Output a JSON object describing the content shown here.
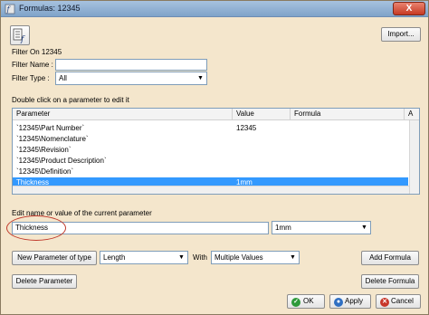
{
  "window": {
    "title": "Formulas: 12345",
    "close_label": "X"
  },
  "toolbar": {
    "import_label": "Import..."
  },
  "filter": {
    "heading": "Filter On 12345",
    "name_label": "Filter Name :",
    "name_value": "",
    "type_label": "Filter Type :",
    "type_value": "All"
  },
  "table": {
    "caption": "Double click on a parameter to edit it",
    "columns": [
      "Parameter",
      "Value",
      "Formula",
      "A"
    ],
    "rows": [
      {
        "parameter": "`12345\\Part Number`",
        "value": "12345",
        "formula": ""
      },
      {
        "parameter": "`12345\\Nomenclature`",
        "value": "",
        "formula": ""
      },
      {
        "parameter": "`12345\\Revision`",
        "value": "",
        "formula": ""
      },
      {
        "parameter": "`12345\\Product Description`",
        "value": "",
        "formula": ""
      },
      {
        "parameter": "`12345\\Definition`",
        "value": "",
        "formula": ""
      },
      {
        "parameter": "Thickness",
        "value": "1mm",
        "formula": "",
        "selected": true
      }
    ]
  },
  "edit": {
    "caption": "Edit name or value of the current parameter",
    "name_value": "Thickness",
    "value_value": "1mm"
  },
  "new_param": {
    "button_label": "New Parameter of type",
    "type_value": "Length",
    "with_label": "With",
    "with_value": "Multiple Values",
    "add_formula_label": "Add Formula"
  },
  "actions": {
    "delete_parameter_label": "Delete Parameter",
    "delete_formula_label": "Delete Formula",
    "ok_label": "OK",
    "apply_label": "Apply",
    "cancel_label": "Cancel"
  },
  "colors": {
    "selection": "#3399ff",
    "dialog_bg": "#f4e6cc",
    "highlight_circle": "#c0392b"
  }
}
